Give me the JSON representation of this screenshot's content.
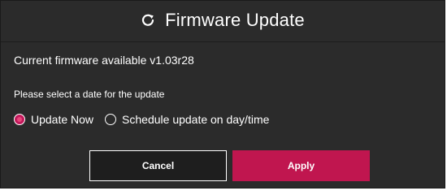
{
  "dialog": {
    "title": "Firmware Update",
    "title_icon": "refresh-icon",
    "current_firmware_text": "Current firmware available v1.03r28",
    "date_prompt": "Please select a date for the update",
    "options": [
      {
        "label": "Update Now",
        "selected": true
      },
      {
        "label": "Schedule update on day/time",
        "selected": false
      }
    ],
    "cancel_label": "Cancel",
    "apply_label": "Apply"
  },
  "colors": {
    "background": "#2b2b2b",
    "accent": "#c0164f",
    "text": "#ffffff"
  }
}
